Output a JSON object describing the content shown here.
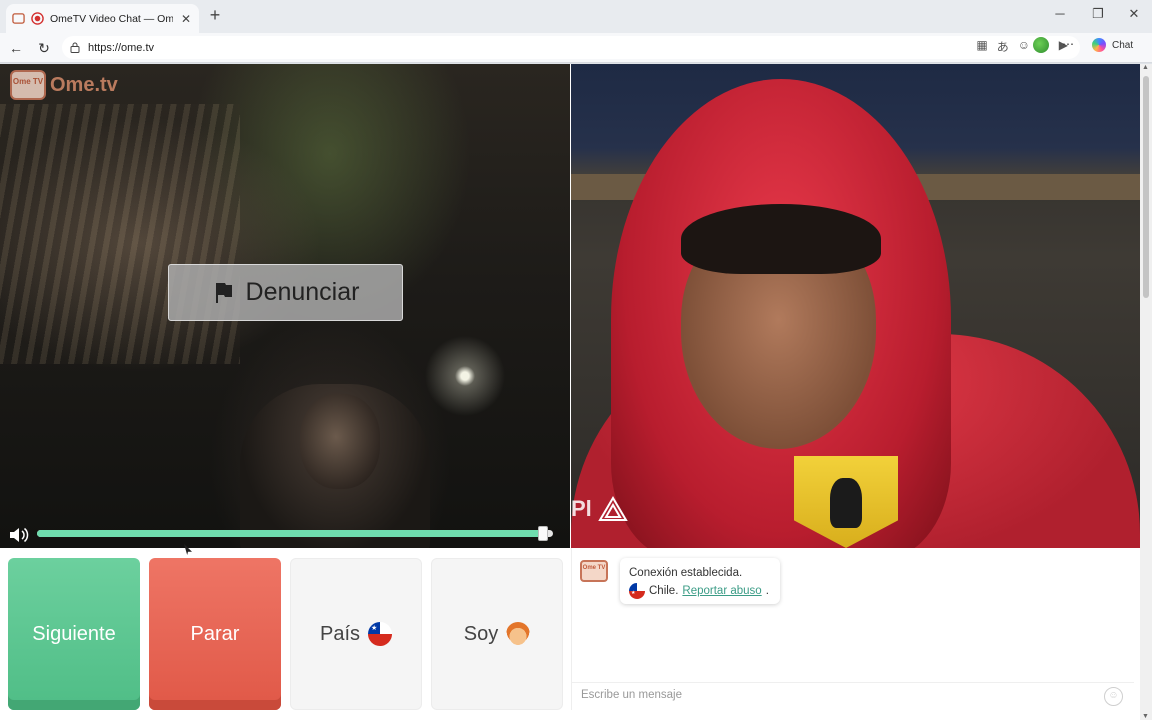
{
  "browser": {
    "tab_title": "OmeTV Video Chat — Omegl",
    "url": "https://ome.tv",
    "chat_button": "Chat",
    "new_tab_icon": "plus-icon",
    "window_controls": [
      "minimize-icon",
      "restore-icon",
      "close-icon"
    ],
    "toolbar_icons": [
      "apps-icon",
      "translate-icon",
      "emoji-icon",
      "favorite-icon",
      "camera-icon",
      "profile-icon",
      "more-icon"
    ]
  },
  "site": {
    "logo_text": "Ome.tv",
    "logo_badge": "Ome TV",
    "report_button": "Denunciar",
    "volume_level": 0.98
  },
  "controls": {
    "next": "Siguiente",
    "stop": "Parar",
    "country": "País",
    "country_flag": "chile-flag",
    "gender": "Soy",
    "gender_icon": "boy-avatar"
  },
  "chat": {
    "status": "Conexión establecida.",
    "country": "Chile.",
    "report_link": "Reportar abuso",
    "report_suffix": ".",
    "input_placeholder": "Escribe un mensaje"
  },
  "colors": {
    "next_button": "#5cc592",
    "stop_button": "#e8604f",
    "link": "#3b9c86",
    "volume_fill": "#6fdcae"
  }
}
